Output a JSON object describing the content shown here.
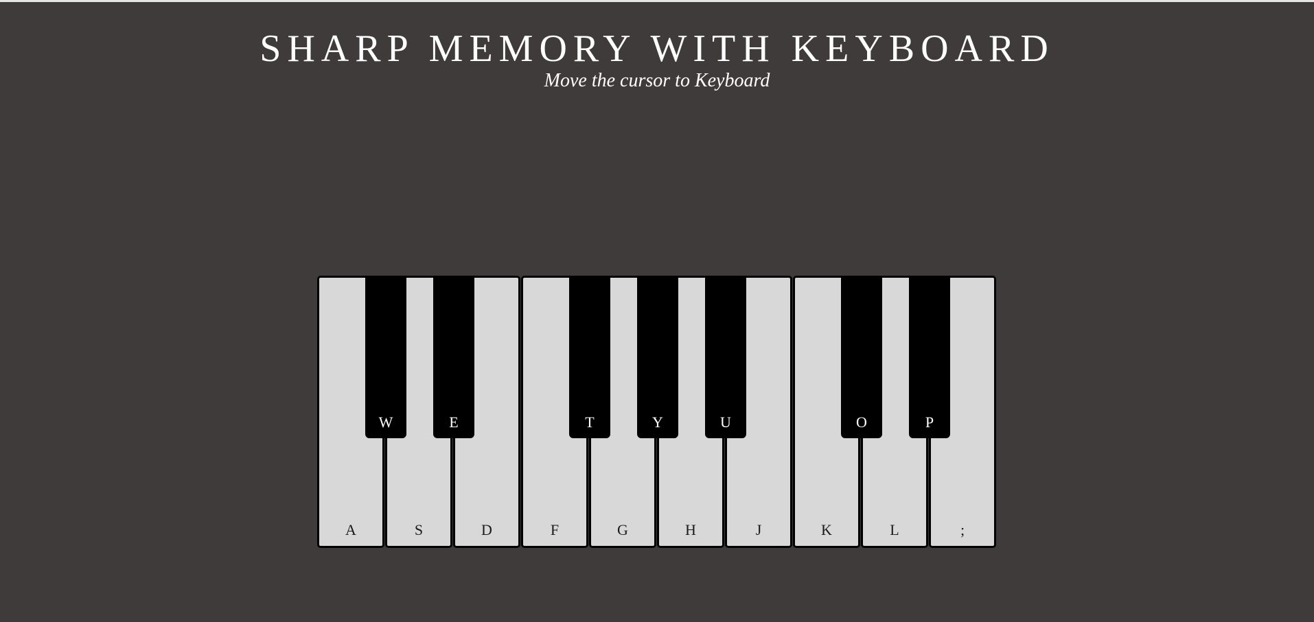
{
  "header": {
    "title": "SHARP MEMORY WITH KEYBOARD",
    "subtitle": "Move the cursor to Keyboard"
  },
  "keyboard": {
    "white_keys": [
      "A",
      "S",
      "D",
      "F",
      "G",
      "H",
      "J",
      "K",
      "L",
      ";"
    ],
    "black_keys": [
      "W",
      "E",
      "T",
      "Y",
      "U",
      "O",
      "P"
    ]
  },
  "colors": {
    "background": "#403b3b",
    "white_key": "#d8d8d8",
    "black_key": "#000000",
    "text": "#ffffff"
  }
}
